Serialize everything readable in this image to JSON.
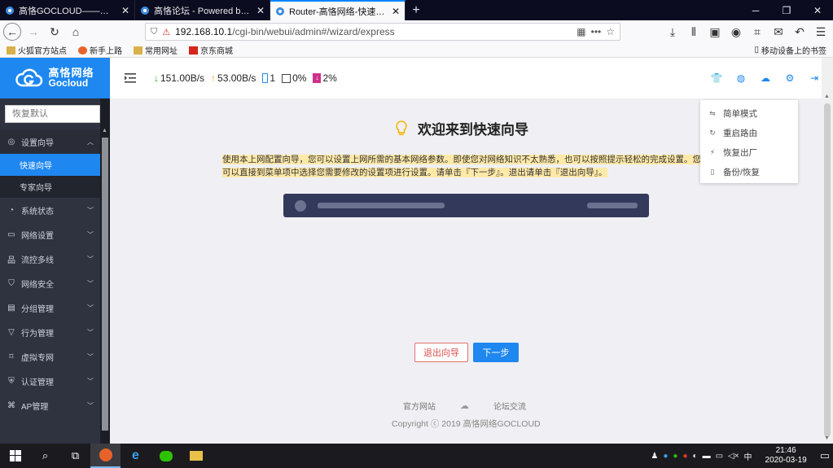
{
  "browser": {
    "tabs": [
      {
        "title": "高恪GOCLOUD——专注于企业",
        "active": false
      },
      {
        "title": "高恪论坛 - Powered by Discuz",
        "active": false
      },
      {
        "title": "Router-高恪网络-快速向导",
        "active": true
      }
    ],
    "url_host": "192.168.10.1",
    "url_path": "/cgi-bin/webui/admin#/wizard/express",
    "bookmarks": [
      "火狐官方站点",
      "新手上路",
      "常用网址",
      "京东商城"
    ],
    "mobile_bookmarks": "移动设备上的书签"
  },
  "header": {
    "logo_cn": "高恪网络",
    "logo_en": "Gocloud",
    "download_speed": "151.00B/s",
    "upload_speed": "53.00B/s",
    "devices": "1",
    "cpu": "0%",
    "memory": "2%"
  },
  "sidebar": {
    "search_placeholder": "恢复默认",
    "open_group": "设置向导",
    "sub_items": [
      {
        "label": "快速向导",
        "active": true
      },
      {
        "label": "专家向导",
        "active": false
      }
    ],
    "items": [
      {
        "label": "系统状态",
        "icon": "gauge-icon"
      },
      {
        "label": "网络设置",
        "icon": "monitor-icon"
      },
      {
        "label": "流控多线",
        "icon": "network-icon"
      },
      {
        "label": "网络安全",
        "icon": "shield-icon"
      },
      {
        "label": "分组管理",
        "icon": "book-icon"
      },
      {
        "label": "行为管理",
        "icon": "filter-icon"
      },
      {
        "label": "虚拟专网",
        "icon": "vpn-icon"
      },
      {
        "label": "认证管理",
        "icon": "check-shield-icon"
      },
      {
        "label": "AP管理",
        "icon": "ap-icon"
      }
    ]
  },
  "wizard": {
    "title": "欢迎来到快速向导",
    "intro": "使用本上网配置向导，您可以设置上网所需的基本网络参数。即使您对网络知识不太熟悉，也可以按照提示轻松的完成设置。您也可以直接到菜单项中选择您需要修改的设置项进行设置。请单击『下一步』。退出请单击『退出向导』。",
    "exit_label": "退出向导",
    "next_label": "下一步"
  },
  "footer": {
    "official_site": "官方网站",
    "forum": "论坛交流",
    "copyright": "Copyright ⓒ 2019 高恪网络GOCLOUD"
  },
  "settings_menu": [
    {
      "label": "简单模式",
      "icon": "switch-icon"
    },
    {
      "label": "重启路由",
      "icon": "restart-icon"
    },
    {
      "label": "恢复出厂",
      "icon": "reset-icon"
    },
    {
      "label": "备份/恢复",
      "icon": "backup-icon"
    }
  ],
  "taskbar": {
    "ime": "中",
    "time": "21:46",
    "date": "2020-03-19"
  },
  "colors": {
    "brand": "#1e87f0",
    "sidebar_bg": "#2f3340",
    "highlight": "#ffe9a8",
    "danger": "#e05050"
  }
}
